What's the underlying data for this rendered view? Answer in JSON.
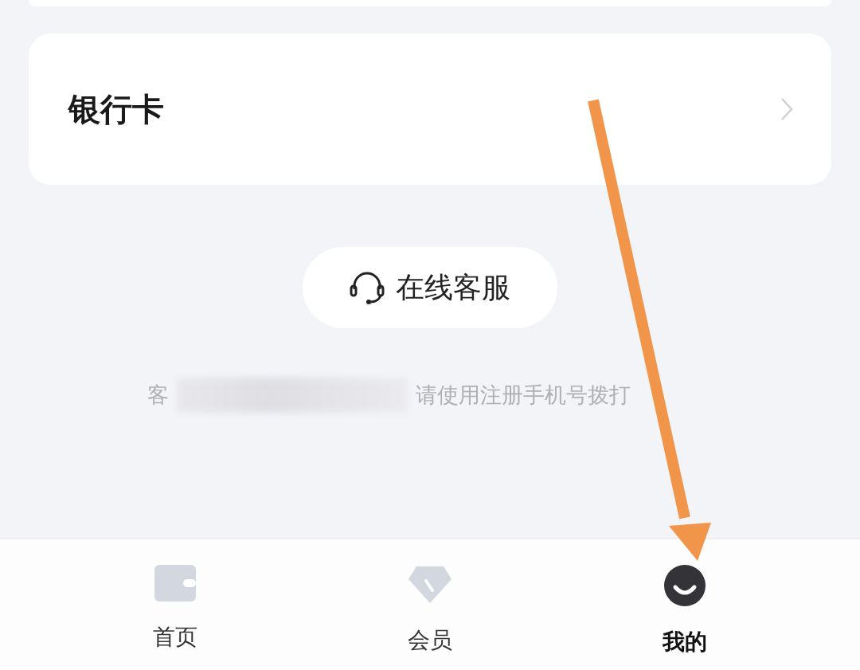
{
  "bank_card": {
    "label": "银行卡"
  },
  "support_button": {
    "label": "在线客服"
  },
  "hotline_note": {
    "lead": "客",
    "tail": "请使用注册手机号拨打"
  },
  "tab_bar": [
    {
      "label": "首页",
      "kind": "wallet",
      "selected": false
    },
    {
      "label": "会员",
      "kind": "diamond",
      "selected": false
    },
    {
      "label": "我的",
      "kind": "face",
      "selected": true
    }
  ]
}
